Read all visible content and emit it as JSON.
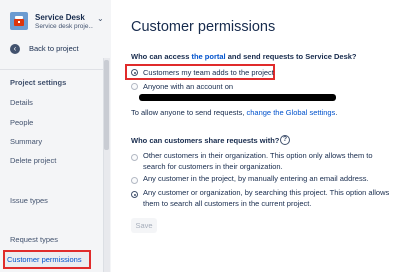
{
  "project": {
    "name": "Service Desk",
    "subtitle": "Service desk proje..."
  },
  "sidebar": {
    "back_label": "Back to project",
    "section_title": "Project settings",
    "items": [
      {
        "label": "Details"
      },
      {
        "label": "People"
      },
      {
        "label": "Summary"
      },
      {
        "label": "Delete project"
      },
      {
        "label": "Issue types"
      },
      {
        "label": "Request types"
      },
      {
        "label": "Customer permissions"
      }
    ],
    "active_item": "Customer permissions"
  },
  "main": {
    "title": "Customer permissions",
    "access_question": {
      "prefix": "Who can access ",
      "link": "the portal",
      "suffix": " and send requests to Service Desk?"
    },
    "access_options": [
      {
        "label": "Customers my team adds to the project",
        "checked": true
      },
      {
        "label": "Anyone with an account on",
        "checked": false
      }
    ],
    "allow_text": {
      "prefix": "To allow anyone to send requests, ",
      "link": "change the Global settings",
      "suffix": "."
    },
    "share_question": "Who can customers share requests with?",
    "share_options": [
      {
        "label": "Other customers in their organization. This option only allows them to search for customers in their organization.",
        "checked": false
      },
      {
        "label": "Any customer in the project, by manually entering an email address.",
        "checked": false
      },
      {
        "label": "Any customer or organization, by searching this project. This option allows them to search all customers in the current project.",
        "checked": true
      }
    ],
    "save_label": "Save"
  },
  "colors": {
    "sidebar_bg": "#f4f5f7",
    "link": "#0052cc",
    "highlight_border": "#e02b2b",
    "text": "#172b4d"
  }
}
